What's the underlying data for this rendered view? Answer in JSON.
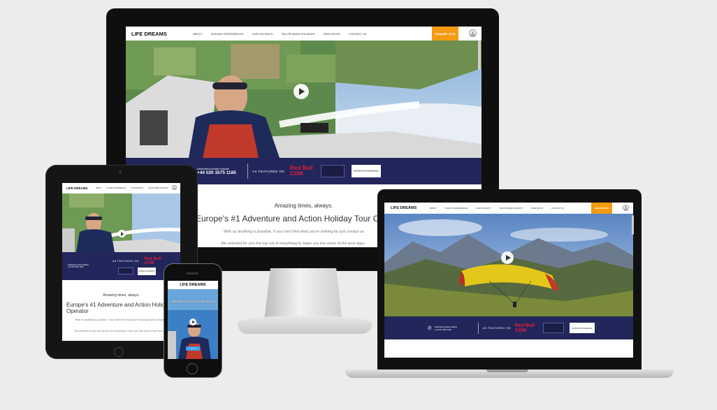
{
  "site": {
    "logo": "LIFE DREAMS",
    "nav": [
      "ABOUT",
      "HOLIDAY EXPERIENCES",
      "OUR HOLIDAYS",
      "TAILOR MADE HOLIDAYS",
      "VIDEO BLOG",
      "CONTACT US"
    ],
    "enquire": "ENQUIRE NOW"
  },
  "band": {
    "phone_label": "Dedicated private helpline",
    "phone_number": "+44 020 3575 1185",
    "featured": "AS FEATURED ON",
    "redbull_top": "Red Bull",
    "redbull_bottom": "COM",
    "partner_logo": "INTERCONTINENTAL"
  },
  "content": {
    "tagline": "Amazing times, always.",
    "heading": "Europe's #1 Adventure and Action Holiday Tour Operator",
    "p1": "With us anything is possible. If you can't find what you're looking for just contact us",
    "p2": "We selected for you the top out of everything to make you live some of the best days"
  },
  "mobile": {
    "hero_text": "UNFORGETTABLE FUN THE WORLD",
    "button": "Find Out"
  },
  "colors": {
    "band": "#22265a",
    "accent": "#f39c12",
    "mobile_button": "#3aa0ff"
  }
}
